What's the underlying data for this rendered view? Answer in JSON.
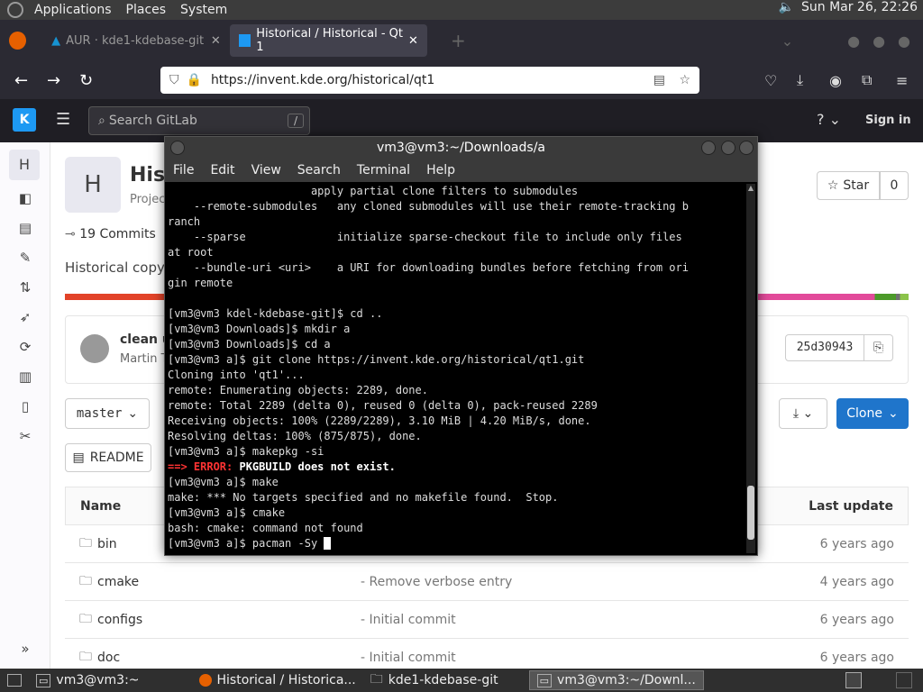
{
  "topbar": {
    "menus": [
      "Applications",
      "Places",
      "System"
    ],
    "clock": "Sun Mar 26, 22:26"
  },
  "browser": {
    "tabs": [
      {
        "label": "AUR · kde1-kdebase-git"
      },
      {
        "label": "Historical / Historical - Qt 1"
      }
    ],
    "url": "https://invent.kde.org/historical/qt1"
  },
  "gitlab": {
    "search_placeholder": "Search GitLab",
    "search_shortcut": "/",
    "sign_in": "Sign in",
    "project_avatar": "H",
    "project_title": "Hist",
    "project_subtitle": "Projec",
    "commits": "19 Commits",
    "description": "Historical copy o",
    "star_label": "Star",
    "star_count": "0",
    "last_commit_title": "clean up",
    "last_commit_author": "Martin T",
    "commit_sha": "25d30943",
    "branch": "master",
    "clone_label": "Clone",
    "readme_label": "README",
    "table_header_name": "Name",
    "table_header_update": "Last update",
    "files": [
      {
        "name": "bin",
        "commit": "",
        "updated": "6 years ago"
      },
      {
        "name": "cmake",
        "commit": "Remove verbose entry",
        "updated": "4 years ago"
      },
      {
        "name": "configs",
        "commit": "Initial commit",
        "updated": "6 years ago"
      },
      {
        "name": "doc",
        "commit": "Initial commit",
        "updated": "6 years ago"
      }
    ]
  },
  "terminal": {
    "title": "vm3@vm3:~/Downloads/a",
    "menu": [
      "File",
      "Edit",
      "View",
      "Search",
      "Terminal",
      "Help"
    ],
    "lines_before_error": "                      apply partial clone filters to submodules\n    --remote-submodules   any cloned submodules will use their remote-tracking b\nranch\n    --sparse              initialize sparse-checkout file to include only files\nat root\n    --bundle-uri <uri>    a URI for downloading bundles before fetching from ori\ngin remote\n\n[vm3@vm3 kdel-kdebase-git]$ cd ..\n[vm3@vm3 Downloads]$ mkdir a\n[vm3@vm3 Downloads]$ cd a\n[vm3@vm3 a]$ git clone https://invent.kde.org/historical/qt1.git\nCloning into 'qt1'...\nremote: Enumerating objects: 2289, done.\nremote: Total 2289 (delta 0), reused 0 (delta 0), pack-reused 2289\nReceiving objects: 100% (2289/2289), 3.10 MiB | 4.20 MiB/s, done.\nResolving deltas: 100% (875/875), done.\n[vm3@vm3 a]$ makepkg -si",
    "error_prefix": "==> ERROR:",
    "error_text": "PKGBUILD does not exist.",
    "lines_after_error": "[vm3@vm3 a]$ make\nmake: *** No targets specified and no makefile found.  Stop.\n[vm3@vm3 a]$ cmake\nbash: cmake: command not found",
    "prompt_line": "[vm3@vm3 a]$ pacman -Sy "
  },
  "taskbar": {
    "items": [
      "vm3@vm3:~",
      "Historical / Historica...",
      "kde1-kdebase-git",
      "vm3@vm3:~/Downl..."
    ]
  }
}
